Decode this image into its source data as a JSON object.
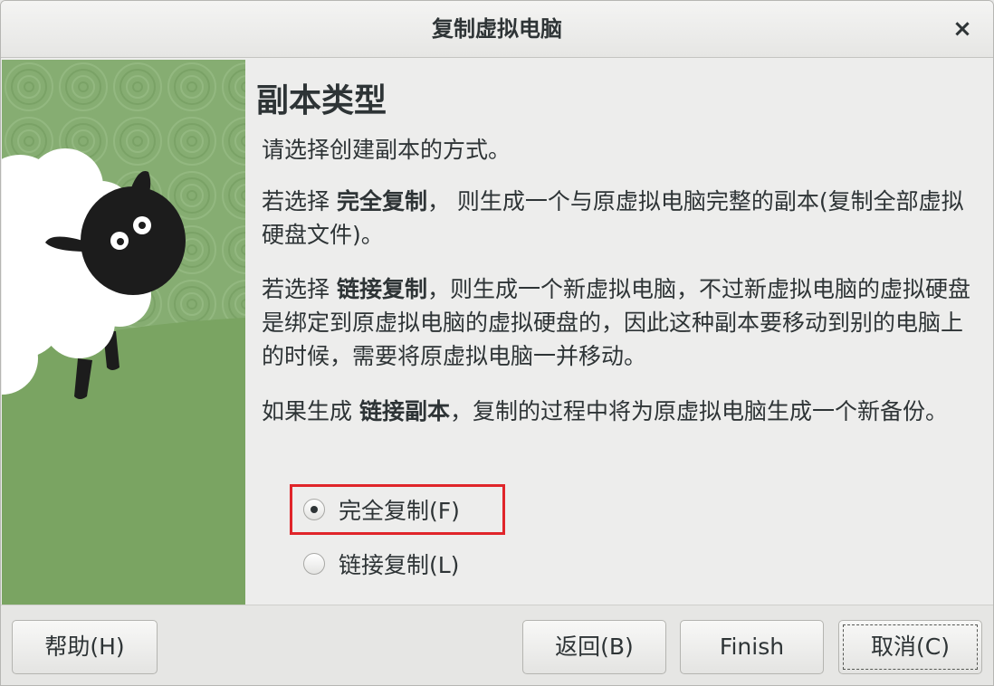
{
  "window": {
    "title": "复制虚拟电脑",
    "close_glyph": "×"
  },
  "page": {
    "heading": "副本类型",
    "intro": "请选择创建副本的方式。",
    "full_clone_para": {
      "prefix": "若选择 ",
      "bold": "完全复制",
      "suffix": "， 则生成一个与原虚拟电脑完整的副本(复制全部虚拟硬盘文件)。"
    },
    "linked_clone_para": {
      "prefix": "若选择 ",
      "bold": "链接复制",
      "suffix": "，则生成一个新虚拟电脑，不过新虚拟电脑的虚拟硬盘是绑定到原虚拟电脑的虚拟硬盘的，因此这种副本要移动到别的电脑上的时候，需要将原虚拟电脑一并移动。"
    },
    "snapshot_para": {
      "prefix": "如果生成 ",
      "bold": "链接副本",
      "suffix": "，复制的过程中将为原虚拟电脑生成一个新备份。"
    }
  },
  "options": [
    {
      "label": "完全复制(F)",
      "selected": true
    },
    {
      "label": "链接复制(L)",
      "selected": false
    }
  ],
  "buttons": {
    "help": "帮助(H)",
    "back": "返回(B)",
    "finish": "Finish",
    "cancel": "取消(C)"
  },
  "colors": {
    "highlight": "#e0252a",
    "grass": "#7fa76a"
  }
}
